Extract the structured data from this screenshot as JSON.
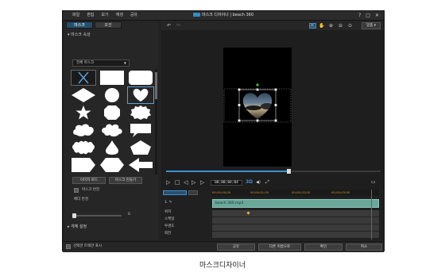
{
  "window": {
    "menu": [
      "파일",
      "편집",
      "보기",
      "재생",
      "공유"
    ],
    "title": "마스크 디자이너 | beach 360",
    "controls": [
      "?",
      "□",
      "✕"
    ]
  },
  "left_panel": {
    "tabs": [
      "마스크",
      "모션"
    ],
    "mask_props_header": "마스크 속성",
    "mask_type": "전체 마스크",
    "shapes": [
      {
        "name": "none"
      },
      {
        "name": "rectangle"
      },
      {
        "name": "rounded-rectangle"
      },
      {
        "name": "diamond"
      },
      {
        "name": "circle"
      },
      {
        "name": "heart",
        "selected": true
      },
      {
        "name": "star"
      },
      {
        "name": "octagon"
      },
      {
        "name": "badge"
      },
      {
        "name": "cloud"
      },
      {
        "name": "cloud-2"
      },
      {
        "name": "speech-bubble"
      },
      {
        "name": "scallop"
      },
      {
        "name": "drop"
      },
      {
        "name": "pentagon"
      },
      {
        "name": "tag"
      },
      {
        "name": "hexagon"
      },
      {
        "name": "arrow"
      }
    ],
    "import_image_button": "이미지 로드",
    "create_mask_button": "마스크 만들기",
    "invert_mask_label": "마스크 반전",
    "feather_label": "페더 반경",
    "feather_value": "0",
    "object_settings": "개체 설정",
    "show_selected_label": "선택한 트랙만 표시"
  },
  "preview": {
    "zoom": "맞춤",
    "timecode": "00;00;04;04",
    "fps_badge": "3D",
    "progress": 0.57
  },
  "timeline": {
    "ruler": [
      "00;00;00;00",
      "00;00;01;00",
      "00;00;02;00",
      "00;00;03;00"
    ],
    "clip_name": "beach 360.mp4",
    "tracks": [
      "1. ✎",
      "위치",
      "스케일",
      "투명도",
      "회전"
    ]
  },
  "bottom": {
    "share": "공유",
    "save_as": "다른 이름으로",
    "ok": "확인",
    "cancel": "취소"
  },
  "caption": "마스크디자이너"
}
